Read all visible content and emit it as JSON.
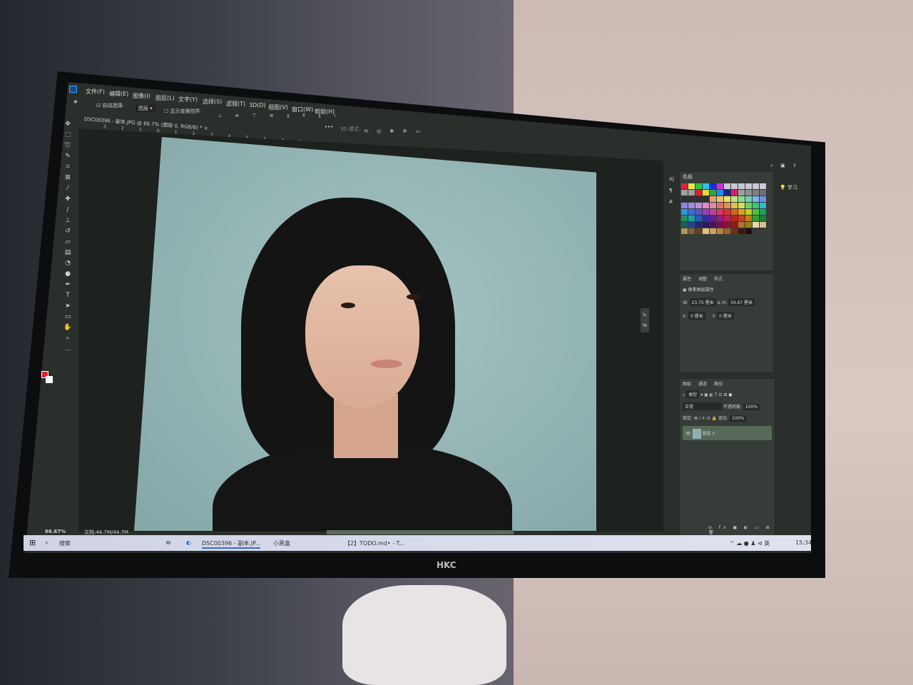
{
  "app": {
    "logo": "Ps"
  },
  "menu": [
    "文件(F)",
    "编辑(E)",
    "图像(I)",
    "图层(L)",
    "文字(Y)",
    "选择(S)",
    "滤镜(T)",
    "3D(D)",
    "视图(V)",
    "窗口(W)",
    "帮助(H)"
  ],
  "options": {
    "auto_select": "自动选择:",
    "layer_dropdown": "图层",
    "show_transform": "显示变换控件",
    "mode_3d": "3D 模式:"
  },
  "document_tab": "DSC00396 - 副本.JPG @ 66.7% (图层 0, RGB/8) *",
  "ruler_ticks": [
    "3",
    "2",
    "1",
    "0",
    "1",
    "2",
    "3",
    "4",
    "5",
    "6",
    "7",
    "8",
    "9",
    "10",
    "11",
    "12",
    "13",
    "14",
    "15",
    "16",
    "17",
    "18",
    "19",
    "20",
    "21",
    "22",
    "23",
    "24",
    "25",
    "26",
    "27"
  ],
  "swatches": {
    "title": "色板",
    "colors": [
      "#e0203a",
      "#f0e84a",
      "#2fc44a",
      "#22c8e0",
      "#1a2ee0",
      "#d030d8",
      "#c8c8d8",
      "#c8c8d8",
      "#c8c8d8",
      "#c8c8d8",
      "#c8c8d8",
      "#c8c8d8",
      "#a0a0a0",
      "#a0a0a0",
      "#e02030",
      "#f0d040",
      "#28a848",
      "#2090e0",
      "#202080",
      "#d02070",
      "#a0a0a0",
      "#909090",
      "#808080",
      "#707070",
      "#303030",
      "#303030",
      "#303030",
      "#303030",
      "#e8a070",
      "#e8c070",
      "#e8e070",
      "#c0e080",
      "#90d890",
      "#70d0c0",
      "#70b8e8",
      "#7090e8",
      "#8888e0",
      "#a088e0",
      "#c088e0",
      "#e088d0",
      "#e088a0",
      "#e07070",
      "#e09050",
      "#e0c050",
      "#d0e050",
      "#70d060",
      "#40c080",
      "#30b8d0",
      "#2898e0",
      "#3070e0",
      "#6050d0",
      "#9040c0",
      "#c040a0",
      "#e03070",
      "#e03030",
      "#e06020",
      "#e0a020",
      "#c0d020",
      "#50c040",
      "#20a060",
      "#209060",
      "#20a0a0",
      "#2060c0",
      "#3030a0",
      "#602090",
      "#902080",
      "#c02050",
      "#c02020",
      "#c04020",
      "#c08020",
      "#30a030",
      "#207840",
      "#206050",
      "#204890",
      "#202870",
      "#301860",
      "#501060",
      "#701050",
      "#901030",
      "#901818",
      "#b07030",
      "#908020",
      "#e8d8b0",
      "#d8c090",
      "#b09860",
      "#806040",
      "#604028",
      "#e0c080",
      "#d0a060",
      "#c08040",
      "#a06030",
      "#703018",
      "#401810",
      "#201010"
    ]
  },
  "properties": {
    "tabs": [
      "属性",
      "调整",
      "样式"
    ],
    "section": "像素图层属性",
    "w_label": "W:",
    "w_value": "23.75 厘米",
    "h_label": "H:",
    "h_value": "34.67 厘米",
    "x_label": "X:",
    "x_value": "0 厘米",
    "y_label": "Y:",
    "y_value": "0 厘米"
  },
  "side": {
    "learn": "学习"
  },
  "layers": {
    "tabs": [
      "图层",
      "通道",
      "路径"
    ],
    "filter": "类型",
    "blend": "正常",
    "opacity_label": "不透明度:",
    "opacity": "100%",
    "lock_label": "锁定:",
    "fill_label": "填充:",
    "fill": "100%",
    "layer_name": "图层 0"
  },
  "status": {
    "zoom": "66.67%",
    "doc": "文档:44.7M/44.7M"
  },
  "taskbar": {
    "search": "搜索",
    "items": [
      "DSC00396 - 副本.JP...",
      "小黑盒",
      "【2】TODO.md• - T..."
    ],
    "time": "15:34"
  },
  "monitor_brand": "HKC",
  "colors": {
    "foreground": "#e0202a",
    "background": "#ffffff",
    "ui": "#2a2f2b",
    "canvas": "#8fb0b0"
  }
}
